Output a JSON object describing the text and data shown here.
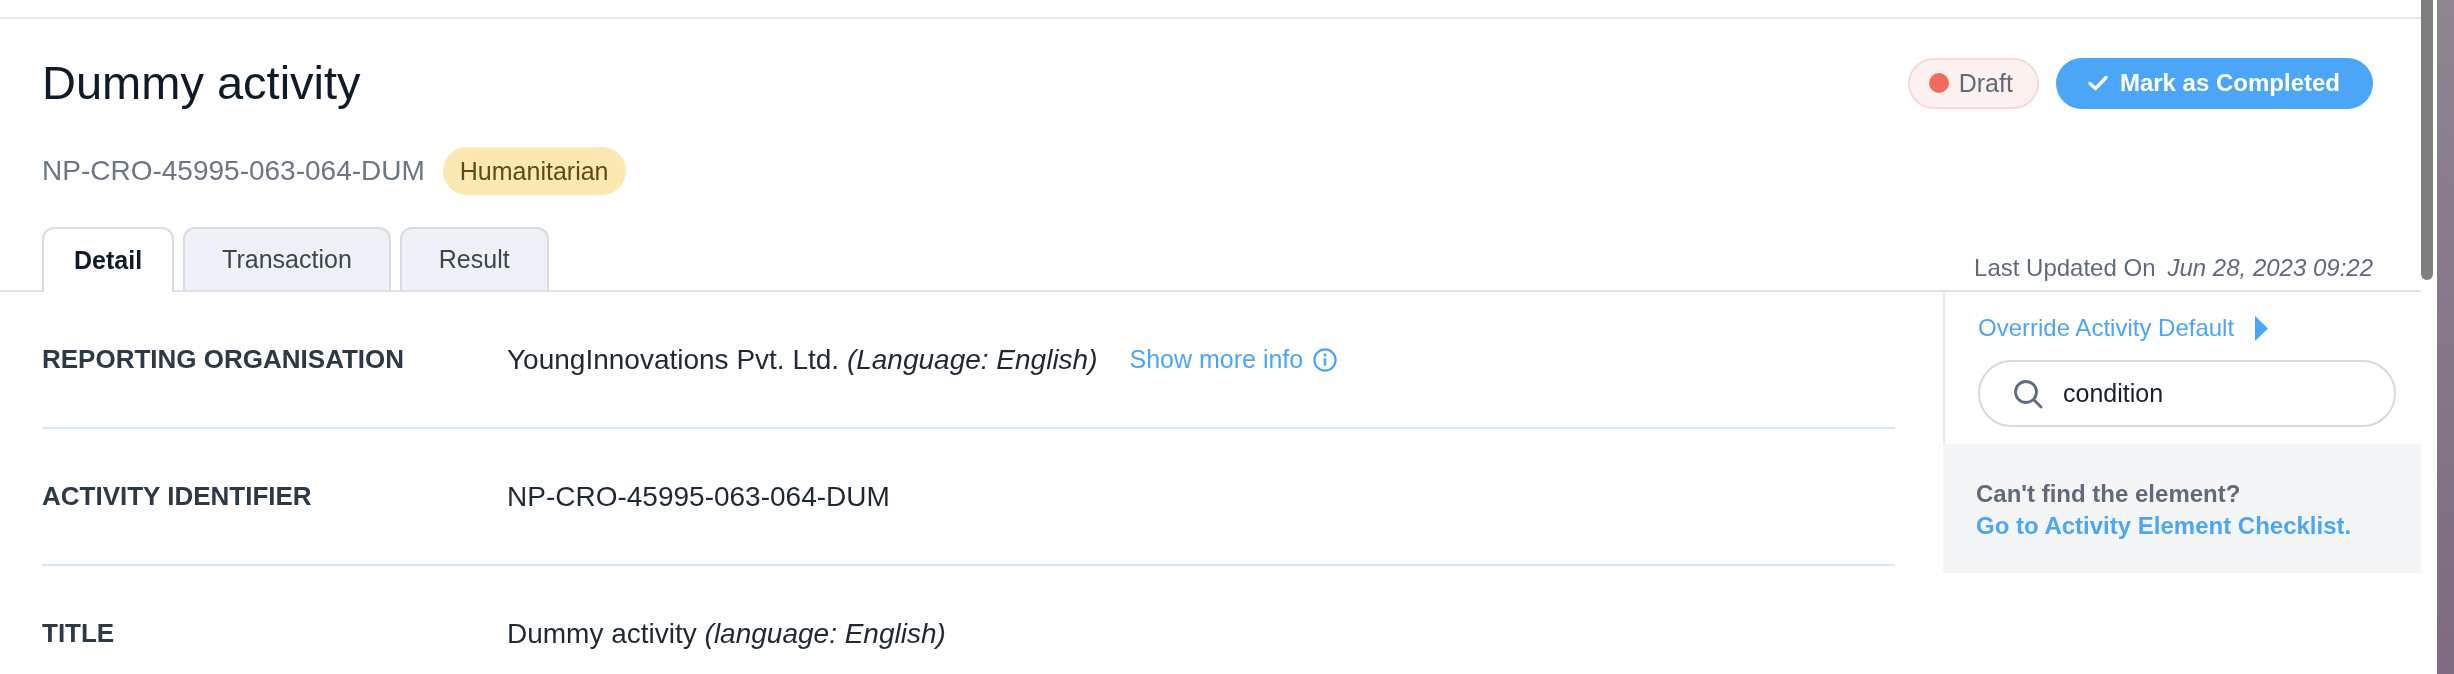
{
  "header": {
    "title": "Dummy activity",
    "status": {
      "label": "Draft",
      "color": "#ee6b5e"
    },
    "action": {
      "label": "Mark as Completed"
    },
    "identifier": "NP-CRO-45995-063-064-DUM",
    "tag": "Humanitarian"
  },
  "tabs": [
    {
      "label": "Detail",
      "selected": true
    },
    {
      "label": "Transaction",
      "selected": false
    },
    {
      "label": "Result",
      "selected": false
    }
  ],
  "last_updated": {
    "label": "Last Updated On",
    "value": "Jun 28, 2023 09:22"
  },
  "fields": [
    {
      "label": "REPORTING ORGANISATION",
      "value": "YoungInnovations Pvt. Ltd. *(Language: English)*",
      "link": "Show more info"
    },
    {
      "label": "ACTIVITY IDENTIFIER",
      "value": "NP-CRO-45995-063-064-DUM"
    },
    {
      "label": "TITLE",
      "value": "Dummy activity *(language: English)*"
    }
  ],
  "sidebar": {
    "override": {
      "label": "Override Activity Default",
      "expanded": false
    },
    "search": {
      "value": "condition"
    },
    "help": {
      "text": "Can't find the element?",
      "link": "Go to Activity Element Checklist."
    }
  }
}
